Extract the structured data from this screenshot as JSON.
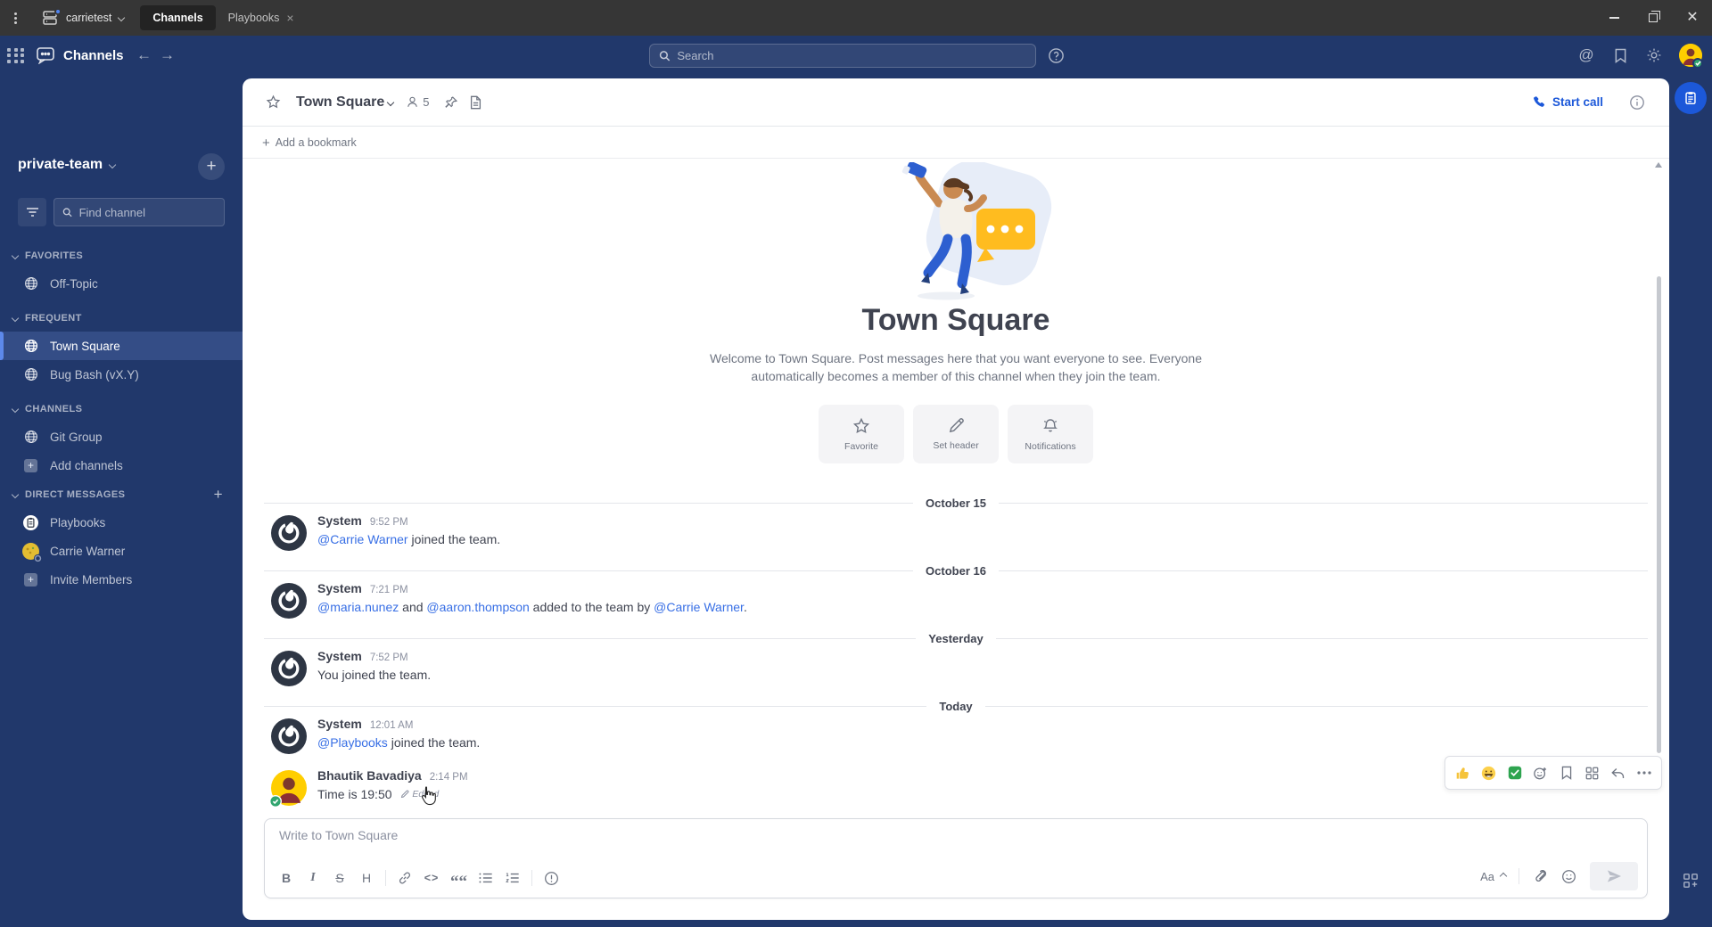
{
  "titlebar": {
    "server_name": "carrietest",
    "tabs": [
      {
        "label": "Channels"
      },
      {
        "label": "Playbooks"
      }
    ]
  },
  "header": {
    "product_title": "Channels",
    "search_placeholder": "Search"
  },
  "sidebar": {
    "team_name": "private-team",
    "find_channel_placeholder": "Find channel",
    "sections": [
      {
        "label": "FAVORITES"
      },
      {
        "label": "FREQUENT"
      },
      {
        "label": "CHANNELS"
      },
      {
        "label": "DIRECT MESSAGES"
      }
    ],
    "favorites_items": [
      {
        "label": "Off-Topic"
      }
    ],
    "frequent_items": [
      {
        "label": "Town Square"
      },
      {
        "label": "Bug Bash (vX.Y)"
      }
    ],
    "channels_items": [
      {
        "label": "Git Group"
      },
      {
        "label": "Add channels"
      }
    ],
    "dm_items": [
      {
        "label": "Playbooks"
      },
      {
        "label": "Carrie Warner"
      },
      {
        "label": "Invite Members"
      }
    ]
  },
  "channel_header": {
    "title": "Town Square",
    "member_count": "5",
    "start_call_label": "Start call"
  },
  "bookmarks": {
    "add_label": "Add a bookmark"
  },
  "intro": {
    "title": "Town Square",
    "welcome_line1": "Welcome to Town Square. Post messages here that you want everyone to see. Everyone",
    "welcome_line2": "automatically becomes a member of this channel when they join the team.",
    "actions": [
      {
        "label": "Favorite"
      },
      {
        "label": "Set header"
      },
      {
        "label": "Notifications"
      }
    ]
  },
  "dividers": [
    {
      "label": "October 15"
    },
    {
      "label": "October 16"
    },
    {
      "label": "Yesterday"
    },
    {
      "label": "Today"
    }
  ],
  "messages": [
    {
      "author": "System",
      "time": "9:52 PM",
      "mention1": "@Carrie Warner",
      "text1": " joined the team."
    },
    {
      "author": "System",
      "time": "7:21 PM",
      "mention1": "@maria.nunez",
      "text1": " and ",
      "mention2": "@aaron.thompson",
      "text2": " added to the team by ",
      "mention3": "@Carrie Warner",
      "text3": "."
    },
    {
      "author": "System",
      "time": "7:52 PM",
      "text1": "You joined the team."
    },
    {
      "author": "System",
      "time": "12:01 AM",
      "mention1": "@Playbooks",
      "text1": " joined the team."
    },
    {
      "author": "Bhautik Bavadiya",
      "time": "2:14 PM",
      "text1": "Time is 19:50",
      "edited_label": "Edited"
    }
  ],
  "composer": {
    "placeholder": "Write to Town Square",
    "bold_label": "B",
    "italic_label": "I",
    "strike_label": "S",
    "heading_label": "H",
    "code_label": "<>",
    "quote_label": "““",
    "format_toggle_label": "Aa"
  },
  "colors": {
    "sidebar_navy": "#21386B",
    "accent_blue": "#1C58D9",
    "link_blue": "#386FE5",
    "selection_blue": "#5D89EA"
  }
}
